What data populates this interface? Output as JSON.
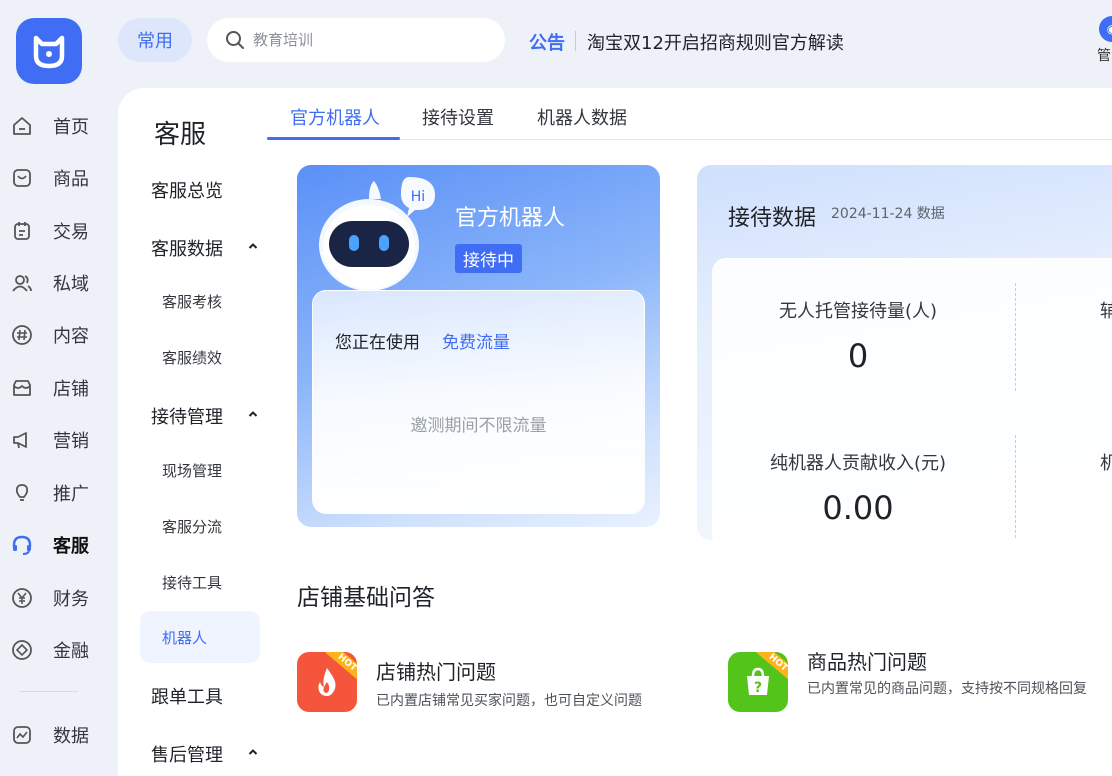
{
  "rail": {
    "items": [
      {
        "label": "首页",
        "icon": "home-icon"
      },
      {
        "label": "商品",
        "icon": "product-icon"
      },
      {
        "label": "交易",
        "icon": "trade-icon"
      },
      {
        "label": "私域",
        "icon": "private-domain-icon"
      },
      {
        "label": "内容",
        "icon": "content-icon"
      },
      {
        "label": "店铺",
        "icon": "shop-icon"
      },
      {
        "label": "营销",
        "icon": "marketing-icon"
      },
      {
        "label": "推广",
        "icon": "promotion-icon"
      },
      {
        "label": "客服",
        "icon": "headset-icon",
        "active": true
      },
      {
        "label": "财务",
        "icon": "yuan-icon"
      },
      {
        "label": "金融",
        "icon": "finance-icon"
      },
      {
        "label": "数据",
        "icon": "data-chart-icon"
      }
    ]
  },
  "topbar": {
    "common_label": "常用",
    "search_placeholder": "教育培训",
    "notice_tag": "公告",
    "notice_text": "淘宝双12开启招商规则官方解读",
    "manager_label": "管"
  },
  "subnav": {
    "title": "客服",
    "overview": "客服总览",
    "service_data": "客服数据",
    "assessment": "客服考核",
    "performance": "客服绩效",
    "reception_mgmt": "接待管理",
    "site_mgmt": "现场管理",
    "diversion": "客服分流",
    "tools": "接待工具",
    "robot": "机器人",
    "follow_tools": "跟单工具",
    "after_sales": "售后管理"
  },
  "tabs": {
    "official_robot": "官方机器人",
    "reception_settings": "接待设置",
    "robot_data": "机器人数据"
  },
  "robot_card": {
    "hi": "Hi",
    "name": "官方机器人",
    "status": "接待中",
    "using_label": "您正在使用",
    "plan": "免费流量",
    "note": "邀测期间不限流量"
  },
  "data_card": {
    "title": "接待数据",
    "date": "2024-11-24 数据",
    "m1_label": "无人托管接待量(人)",
    "m1_value": "0",
    "m2_label": "辅",
    "m3_label": "纯机器人贡献收入(元)",
    "m3_value": "0.00",
    "m4_label": "机器"
  },
  "qa": {
    "title": "店铺基础问答",
    "hot_badge": "HOT",
    "shop": {
      "name": "店铺热门问题",
      "desc": "已内置店铺常见买家问题，也可自定义问题"
    },
    "goods": {
      "name": "商品热门问题",
      "desc": "已内置常见的商品问题，支持按不同规格回复"
    }
  },
  "colors": {
    "accent": "#3f6df3",
    "hot_fire": "#f5553a",
    "hot_goods": "#52c41a"
  }
}
